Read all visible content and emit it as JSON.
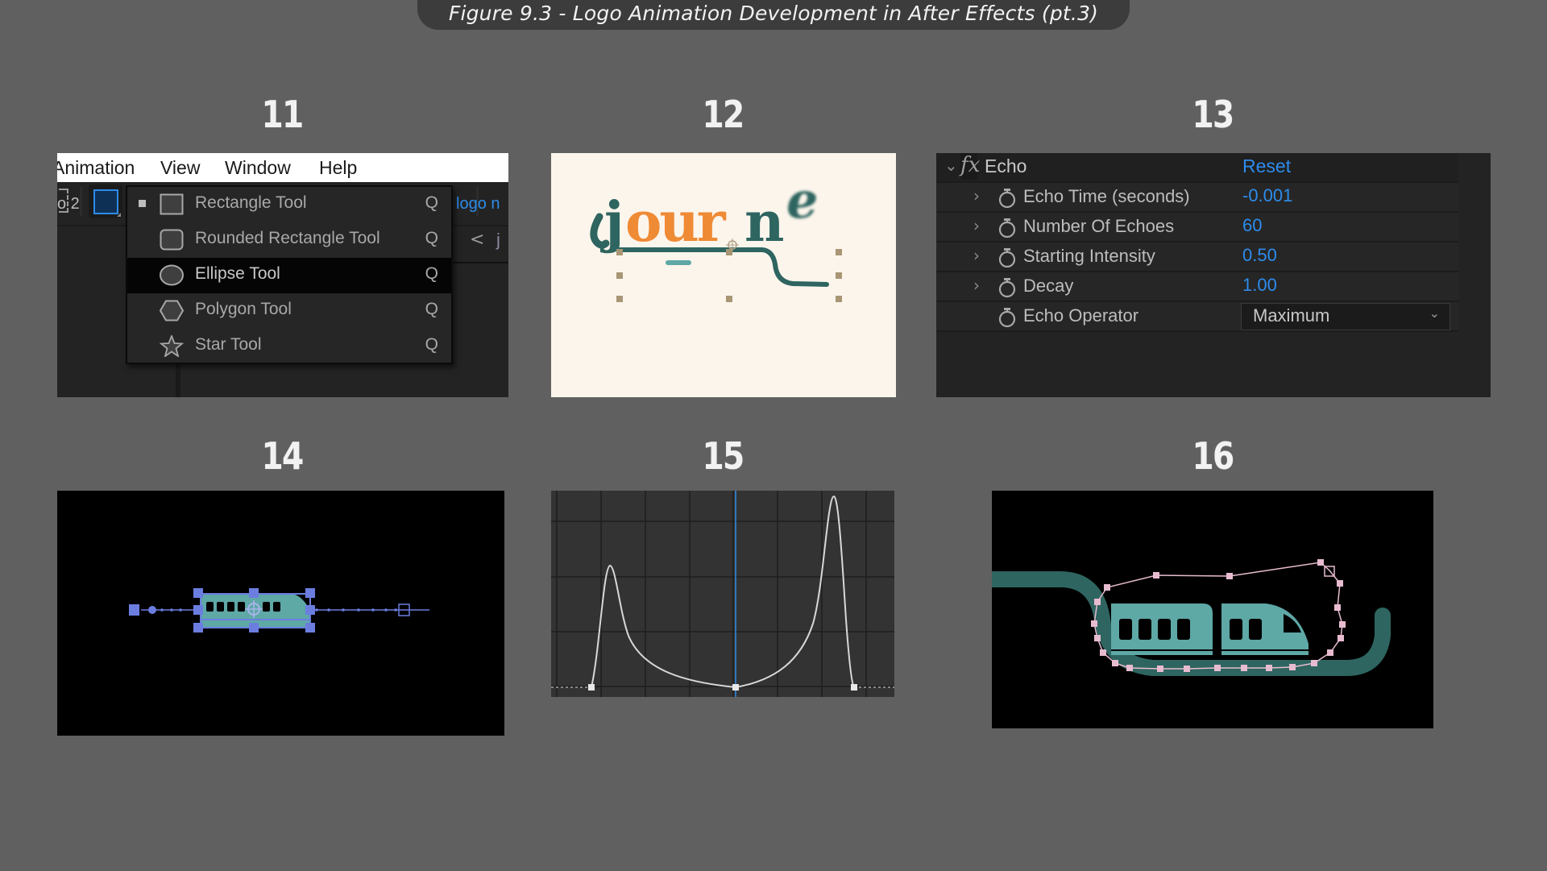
{
  "figure_title": "Figure 9.3 - Logo Animation Development in After Effects (pt.3)",
  "steps": [
    {
      "number": "11",
      "description": "Shape tool menu"
    },
    {
      "number": "12",
      "description": "journe logo animation in progress"
    },
    {
      "number": "13",
      "description": "Echo effect controls"
    },
    {
      "number": "14",
      "description": "Train layer selected with motion path"
    },
    {
      "number": "15",
      "description": "Speed graph"
    },
    {
      "number": "16",
      "description": "Train on track with path keyframes"
    }
  ],
  "panel11": {
    "menubar": [
      "Animation",
      "View",
      "Window",
      "Help"
    ],
    "comp_tab_fragment": "o 2",
    "link_fragment": "logo n",
    "nav_chevron": "<",
    "nav_fragment": "j",
    "shape_menu": [
      {
        "label": "Rectangle Tool",
        "shortcut": "Q",
        "icon": "rectangle-icon",
        "current": true,
        "highlighted": false
      },
      {
        "label": "Rounded Rectangle Tool",
        "shortcut": "Q",
        "icon": "rounded-rectangle-icon",
        "current": false,
        "highlighted": false
      },
      {
        "label": "Ellipse Tool",
        "shortcut": "Q",
        "icon": "ellipse-icon",
        "current": false,
        "highlighted": true
      },
      {
        "label": "Polygon Tool",
        "shortcut": "Q",
        "icon": "polygon-icon",
        "current": false,
        "highlighted": false
      },
      {
        "label": "Star Tool",
        "shortcut": "Q",
        "icon": "star-icon",
        "current": false,
        "highlighted": false
      }
    ]
  },
  "panel12": {
    "logo_text": "journe",
    "logo_parts": [
      {
        "text": "j",
        "color": "#2e6560"
      },
      {
        "text": "our",
        "color": "#ef8a35"
      },
      {
        "text": "n",
        "color": "#2e6560"
      },
      {
        "text": "e",
        "color": "#2e6560"
      }
    ],
    "colors": {
      "background": "#fcf5ec",
      "teal": "#2e6560",
      "orange": "#ef8a35",
      "light_teal": "#5ea8a6",
      "handle": "#a89675"
    }
  },
  "panel13": {
    "effect_name": "Echo",
    "reset_label": "Reset",
    "fx_label": "fx",
    "properties": [
      {
        "label": "Echo Time (seconds)",
        "value": "-0.001"
      },
      {
        "label": "Number Of Echoes",
        "value": "60"
      },
      {
        "label": "Starting Intensity",
        "value": "0.50"
      },
      {
        "label": "Decay",
        "value": "1.00"
      }
    ],
    "operator": {
      "label": "Echo Operator",
      "value": "Maximum"
    },
    "accent_color": "#2d8ceb"
  },
  "panel14": {
    "colors": {
      "selection": "#6b7ee0",
      "train": "#5ea8a6",
      "background": "#000000"
    }
  },
  "panel15": {
    "graph_type": "speed",
    "keyframes": 3,
    "colors": {
      "curve": "#d8d8d8",
      "playhead": "#2d8ceb",
      "grid": "#1e1e1e",
      "background": "#333333"
    }
  },
  "panel16": {
    "colors": {
      "track": "#2e6560",
      "train": "#5ea8a6",
      "path": "#e8bcd0",
      "background": "#000000"
    }
  }
}
